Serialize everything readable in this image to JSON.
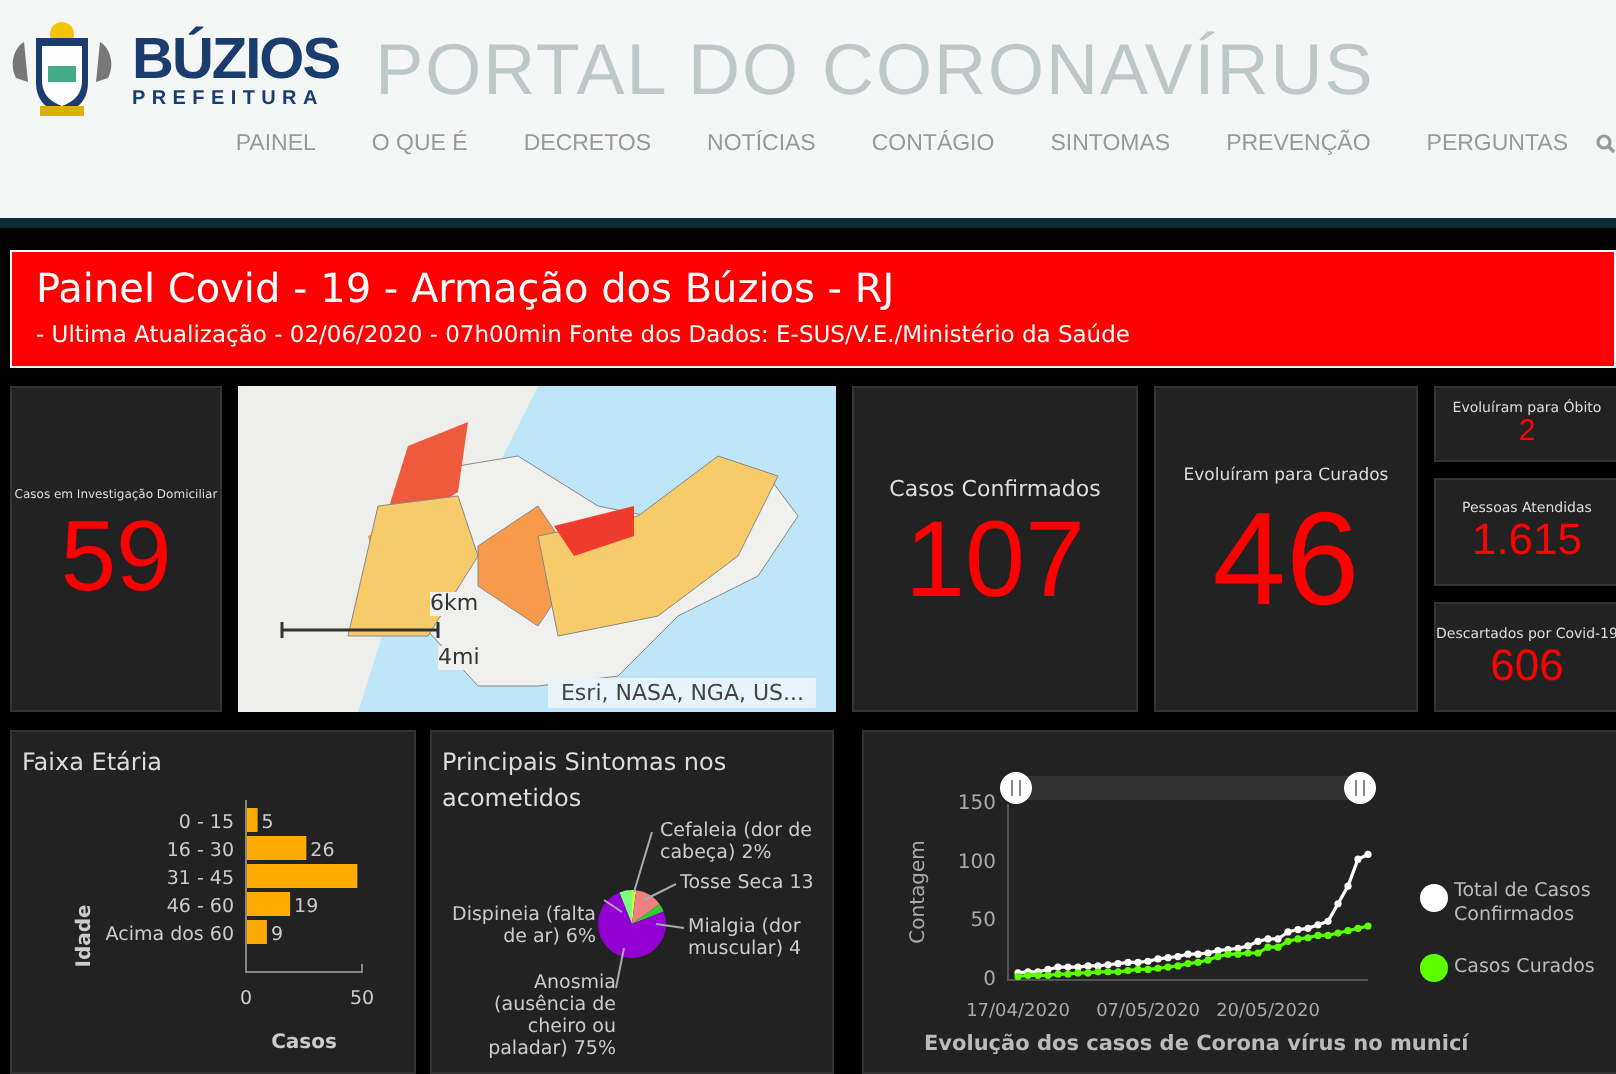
{
  "header": {
    "logo_title": "BÚZIOS",
    "logo_subtitle": "PREFEITURA",
    "site_title": "PORTAL DO CORONAVÍRUS",
    "nav": [
      {
        "label": "PAINEL"
      },
      {
        "label": "O QUE É"
      },
      {
        "label": "DECRETOS"
      },
      {
        "label": "NOTÍCIAS"
      },
      {
        "label": "CONTÁGIO"
      },
      {
        "label": "SINTOMAS"
      },
      {
        "label": "PREVENÇÃO"
      },
      {
        "label": "PERGUNTAS"
      }
    ]
  },
  "banner": {
    "title": "Painel Covid - 19 - Armação dos Búzios - RJ",
    "subtitle": "- Ultima Atualização - 02/06/2020 - 07h00min Fonte dos Dados: E-SUS/V.E./Ministério da Saúde"
  },
  "cards": [
    {
      "kind": "small",
      "label": "Casos em Investigação Domiciliar",
      "value": "59"
    },
    {
      "kind": "large",
      "label": "Casos Confirmados",
      "value": "107"
    },
    {
      "kind": "large",
      "label": "Evoluíram para Curados",
      "value": "46"
    }
  ],
  "side_cards": [
    {
      "label": "Evoluíram para Óbito",
      "value": "2"
    },
    {
      "label": "Pessoas Atendidas",
      "value": "1.615"
    },
    {
      "label": "Descartados por Covid-19",
      "value": "606"
    }
  ],
  "map": {
    "scale_km": "6km",
    "scale_mi": "4mi",
    "attribution": "Esri, NASA, NGA, US..."
  },
  "age_panel": {
    "title": "Faixa Etária",
    "chart_data": {
      "type": "bar",
      "orientation": "horizontal",
      "xlabel": "Casos",
      "ylabel": "Idade",
      "categories": [
        "0 - 15",
        "16 - 30",
        "31 - 45",
        "46 - 60",
        "Acima dos 60"
      ],
      "values": [
        5,
        26,
        48,
        19,
        9
      ],
      "value_labels": [
        "5",
        "26",
        null,
        "19",
        "9"
      ],
      "xlim": [
        0,
        50
      ],
      "xticks": [
        0,
        50
      ]
    }
  },
  "symptoms_panel": {
    "title": "Principais Sintomas nos acometidos",
    "chart_data": {
      "type": "pie",
      "categories": [
        "Cefaleia (dor de cabeça) 2%",
        "Tosse Seca 13",
        "Mialgia (dor muscular) 4",
        "Anosmia (ausência de cheiro ou paladar) 75%",
        "Dispineia (falta de ar) 6%"
      ],
      "values": [
        2,
        13,
        4,
        75,
        6
      ],
      "colors": [
        "#c8ff3c",
        "#f08080",
        "#33cc33",
        "#9400d3",
        "#7fff7f"
      ]
    }
  },
  "evolution_panel": {
    "title": "Evolução dos casos de Corona vírus no municí",
    "chart_data": {
      "type": "line",
      "legend": "right",
      "ylabel": "Contagem",
      "categories": [
        "17/04/2020",
        null,
        null,
        null,
        null,
        null,
        null,
        null,
        null,
        null,
        null,
        null,
        null,
        "07/05/2020",
        null,
        null,
        null,
        null,
        null,
        null,
        null,
        null,
        null,
        null,
        null,
        "20/05/2020",
        null,
        null,
        null,
        null,
        null,
        null,
        null,
        null,
        null,
        null
      ],
      "ylim": [
        0,
        150
      ],
      "yticks": [
        0,
        50,
        100,
        150
      ],
      "series": [
        {
          "name": "Total de Casos Confirmados",
          "color": "#ffffff",
          "marker": "circle",
          "values": [
            6,
            7,
            7,
            9,
            11,
            11,
            11,
            12,
            12,
            13,
            14,
            15,
            15,
            16,
            18,
            19,
            20,
            22,
            22,
            23,
            25,
            26,
            27,
            29,
            33,
            35,
            35,
            41,
            43,
            44,
            47,
            50,
            65,
            80,
            103,
            107
          ]
        },
        {
          "name": "Casos Curados",
          "color": "#5cff00",
          "marker": "circle",
          "values": [
            3,
            4,
            4,
            4,
            5,
            5,
            6,
            6,
            7,
            7,
            7,
            8,
            9,
            9,
            10,
            11,
            12,
            14,
            15,
            17,
            20,
            22,
            22,
            23,
            23,
            28,
            28,
            33,
            35,
            36,
            38,
            38,
            40,
            42,
            44,
            46
          ]
        }
      ]
    }
  }
}
